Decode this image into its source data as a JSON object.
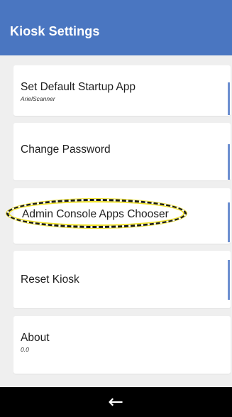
{
  "header": {
    "title": "Kiosk Settings"
  },
  "settings": {
    "items": [
      {
        "label": "Set Default Startup App",
        "sublabel": "ArielScanner"
      },
      {
        "label": "Change Password"
      },
      {
        "label": "Admin Console Apps Chooser"
      },
      {
        "label": "Reset Kiosk"
      },
      {
        "label": "About",
        "sublabel": "0.0"
      }
    ]
  },
  "navbar": {
    "back_icon": "←",
    "back_icon_name": "back-arrow-icon"
  },
  "colors": {
    "header_bg": "#4a76c1",
    "accent_bar": "#6d8fd0",
    "highlight_yellow": "#f0e22a",
    "background": "#efefef"
  }
}
